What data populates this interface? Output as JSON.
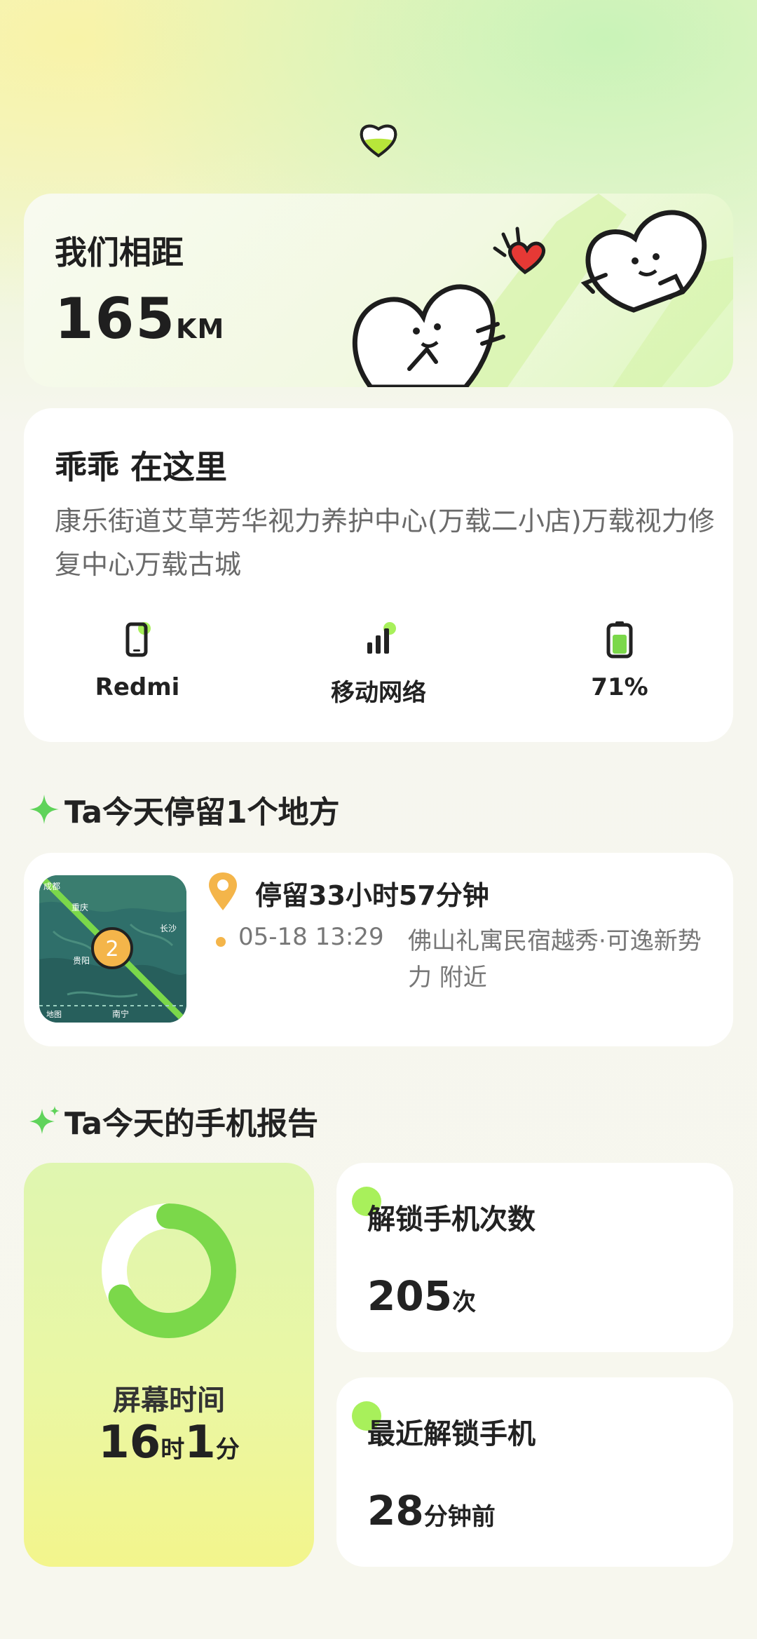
{
  "distance": {
    "label": "我们相距",
    "value": "165",
    "unit": "KM"
  },
  "location": {
    "title": "乖乖 在这里",
    "address": "康乐街道艾草芳华视力养护中心(万载二小店)万载视力修复中心万载古城",
    "device": "Redmi",
    "network": "移动网络",
    "battery": "71%",
    "battery_level": 0.71
  },
  "stay_section": {
    "header": "Ta今天停留1个地方",
    "title": "停留33小时57分钟",
    "time": "05-18 13:29",
    "place": "佛山礼寓民宿越秀·可逸新势力 附近",
    "map": {
      "badge": "2",
      "labels": [
        "成都",
        "重庆",
        "长沙",
        "贵阳",
        "南宁"
      ],
      "watermark": "地图"
    }
  },
  "report_section": {
    "header": "Ta今天的手机报告",
    "screen_time": {
      "label": "屏幕时间",
      "hours": "16",
      "hours_unit": "时",
      "minutes": "1",
      "minutes_unit": "分",
      "fraction": 0.67
    },
    "unlock_count": {
      "title": "解锁手机次数",
      "value": "205",
      "unit": "次"
    },
    "last_unlock": {
      "title": "最近解锁手机",
      "value": "28",
      "unit": "分钟前"
    }
  },
  "colors": {
    "accent": "#7bd84a",
    "pin": "#f4b54a",
    "heart": "#e53935"
  }
}
